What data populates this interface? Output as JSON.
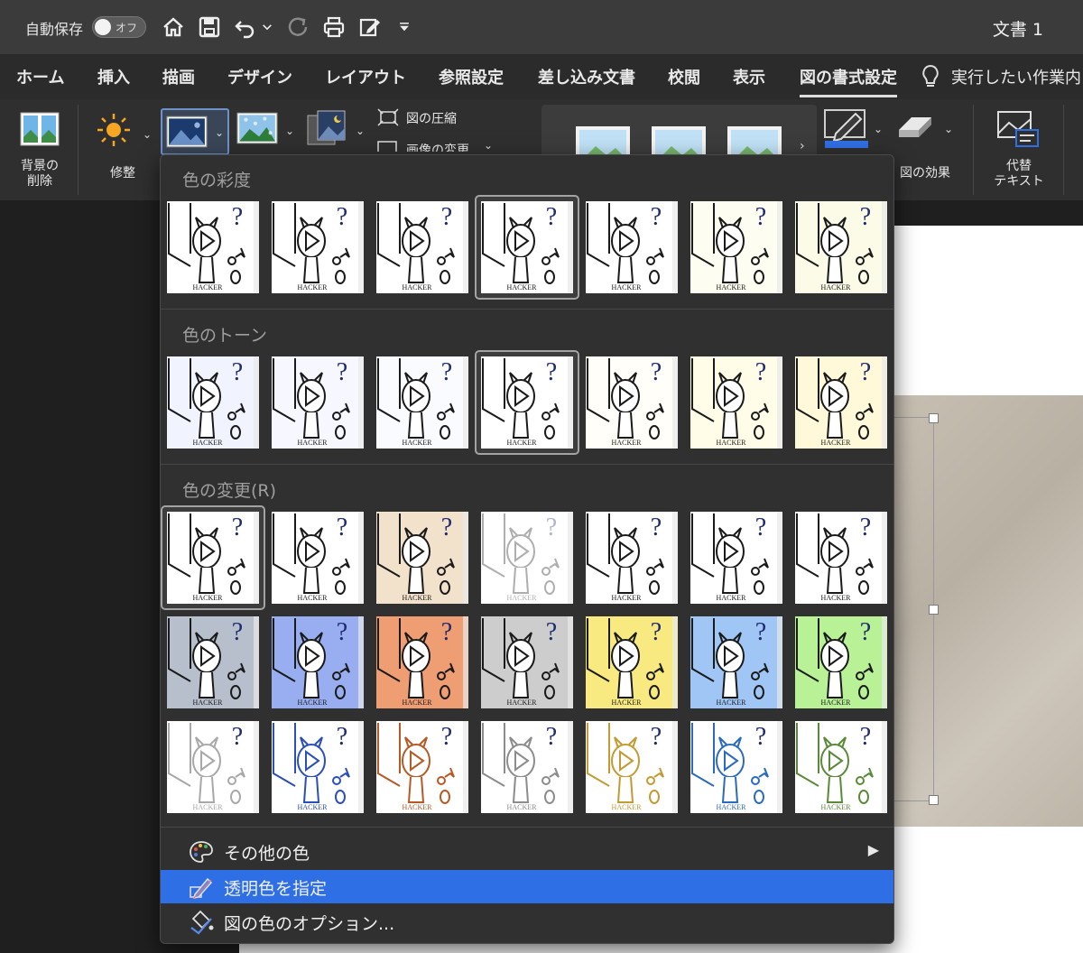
{
  "titlebar": {
    "autosave_label": "自動保存",
    "autosave_state": "オフ",
    "quick_access": [
      "home-icon",
      "save-icon",
      "undo-icon",
      "dropdown-chevron-icon",
      "redo-icon",
      "print-icon",
      "edit-doc-icon",
      "customize-icon"
    ],
    "doc_title": "文書 1"
  },
  "tabs": [
    {
      "label": "ホーム"
    },
    {
      "label": "挿入"
    },
    {
      "label": "描画"
    },
    {
      "label": "デザイン"
    },
    {
      "label": "レイアウト"
    },
    {
      "label": "参照設定"
    },
    {
      "label": "差し込み文書"
    },
    {
      "label": "校閲"
    },
    {
      "label": "表示"
    },
    {
      "label": "図の書式設定"
    }
  ],
  "active_tab": "図の書式設定",
  "tell_me": "実行したい作業内",
  "ribbon": {
    "remove_bg_line1": "背景の",
    "remove_bg_line2": "削除",
    "corrections": "修整",
    "compress": "図の圧縮",
    "change_picture": "画像の変更",
    "picture_effects": "図の効果",
    "alt_text_line1": "代替",
    "alt_text_line2": "テキスト"
  },
  "dropdown": {
    "saturation_title": "色の彩度",
    "tone_title": "色のトーン",
    "recolor_title": "色の変更(R)",
    "thumb_caption": "HACKER",
    "saturation_bg": [
      "#ffffff",
      "#ffffff",
      "#ffffff",
      "#ffffff",
      "#ffffff",
      "#fdfdf2",
      "#fbfbe8"
    ],
    "tone_bg": [
      "#f1f3ff",
      "#f6f7ff",
      "#fafbff",
      "#ffffff",
      "#fffef8",
      "#fffce7",
      "#fff8d9"
    ],
    "recolor_row1_bg": [
      "#ffffff",
      "#ffffff",
      "#f2e2cc",
      "#ffffff",
      "#ffffff",
      "#ffffff",
      "#ffffff"
    ],
    "recolor_row2_bg": [
      "#b7bfcd",
      "#98aef0",
      "#ef9d73",
      "#cdcdcd",
      "#f8ea80",
      "#9fc6f4",
      "#b9f197"
    ],
    "recolor_row3_ink": [
      "#a8a8a8",
      "#2a4fb8",
      "#b65a25",
      "#8c8c8c",
      "#c49a33",
      "#2a6bc0",
      "#5a8a38"
    ],
    "more_colors": "その他の色",
    "set_transparent": "透明色を指定",
    "color_options": "図の色のオプション..."
  }
}
